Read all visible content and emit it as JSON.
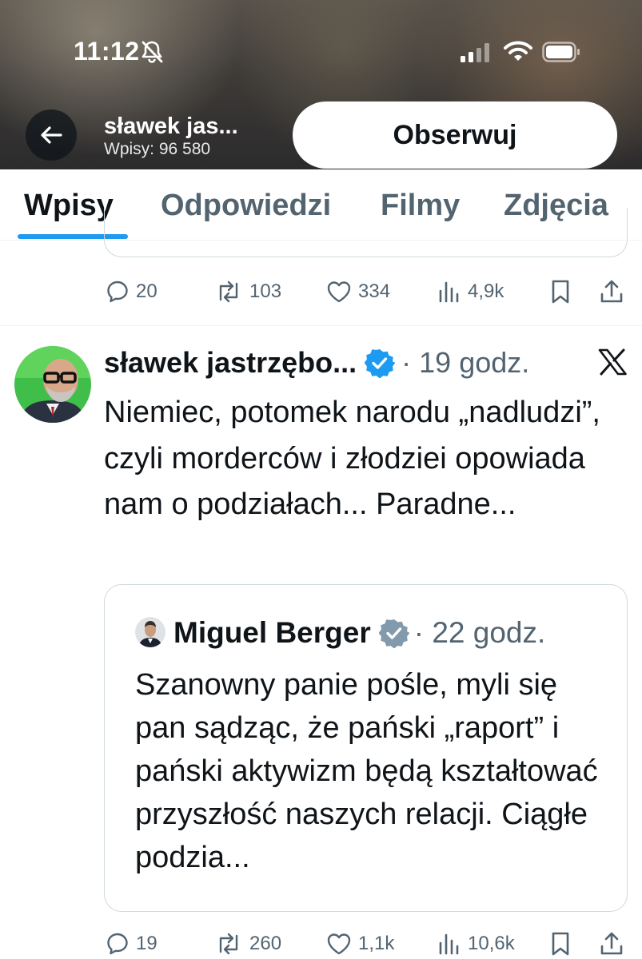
{
  "status_bar": {
    "time": "11:12",
    "bell_icon": "bell-slash-icon",
    "signal_icon": "cellular-signal-icon",
    "wifi_icon": "wifi-icon",
    "battery_icon": "battery-icon"
  },
  "header": {
    "back_icon": "arrow-left-icon",
    "profile_name": "sławek jas...",
    "posts_count": "Wpisy: 96 580",
    "follow_label": "Obserwuj"
  },
  "tabs": [
    {
      "label": "Wpisy",
      "active": true
    },
    {
      "label": "Odpowiedzi",
      "active": false
    },
    {
      "label": "Filmy",
      "active": false
    },
    {
      "label": "Zdjęcia",
      "active": false
    }
  ],
  "previous_post": {
    "actions": {
      "replies": "20",
      "reposts": "103",
      "likes": "334",
      "views": "4,9k"
    }
  },
  "post": {
    "author": "sławek jastrzębo...",
    "time": "· 19 godz.",
    "text": "Niemiec, potomek narodu „nadludzi”, czyli morderców i złodziei opowiada nam o podziałach... Paradne...",
    "quote": {
      "author": "Miguel Berger",
      "time": "· 22 godz.",
      "text": "Szanowny panie pośle, myli się pan sądząc, że pański „raport” i pański aktywizm będą kształtować przyszłość naszych relacji. Ciągłe podzia..."
    },
    "actions": {
      "replies": "19",
      "reposts": "260",
      "likes": "1,1k",
      "views": "10,6k"
    }
  },
  "colors": {
    "accent": "#1d9bf0",
    "secondary_text": "#536471",
    "primary_text": "#0f1419",
    "border": "#cfd9de"
  }
}
